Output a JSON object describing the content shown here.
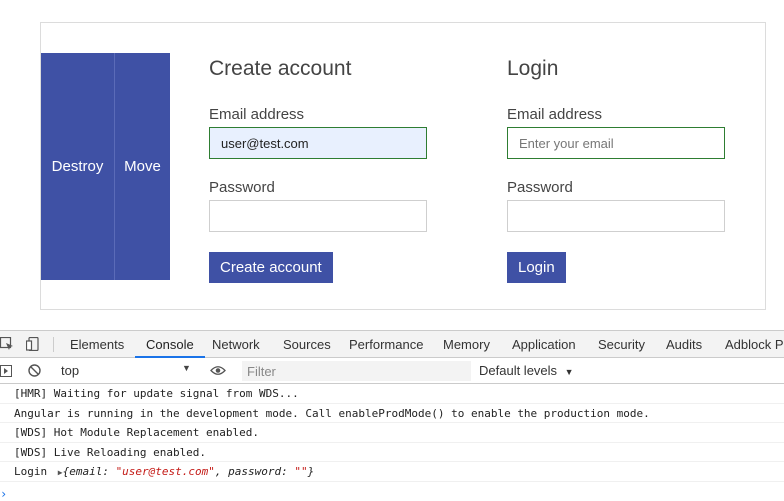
{
  "app": {
    "destroy_label": "Destroy",
    "move_label": "Move",
    "create": {
      "title": "Create account",
      "email_label": "Email address",
      "email_value": "user@test.com",
      "password_label": "Password",
      "password_value": "",
      "submit_label": "Create account"
    },
    "login": {
      "title": "Login",
      "email_label": "Email address",
      "email_placeholder": "Enter your email",
      "password_label": "Password",
      "submit_label": "Login"
    }
  },
  "devtools": {
    "tabs": [
      "Elements",
      "Console",
      "Network",
      "Sources",
      "Performance",
      "Memory",
      "Application",
      "Security",
      "Audits",
      "Adblock Pl"
    ],
    "active_tab": "Console",
    "context": "top",
    "filter_placeholder": "Filter",
    "levels": "Default levels",
    "logs": [
      "[HMR] Waiting for update signal from WDS...",
      "Angular is running in the development mode. Call enableProdMode() to enable the production mode.",
      "[WDS] Hot Module Replacement enabled.",
      "[WDS] Live Reloading enabled."
    ],
    "login_log": {
      "prefix": "Login",
      "open": "{email: ",
      "email": "\"user@test.com\"",
      "mid": ", password: ",
      "password": "\"\"",
      "close": "}"
    }
  },
  "colors": {
    "primary": "#3f51a5",
    "focus_border": "#2e7d32",
    "autofill_bg": "#e8f0fe",
    "devtools_accent": "#1a73e8",
    "string_red": "#c41a16"
  }
}
